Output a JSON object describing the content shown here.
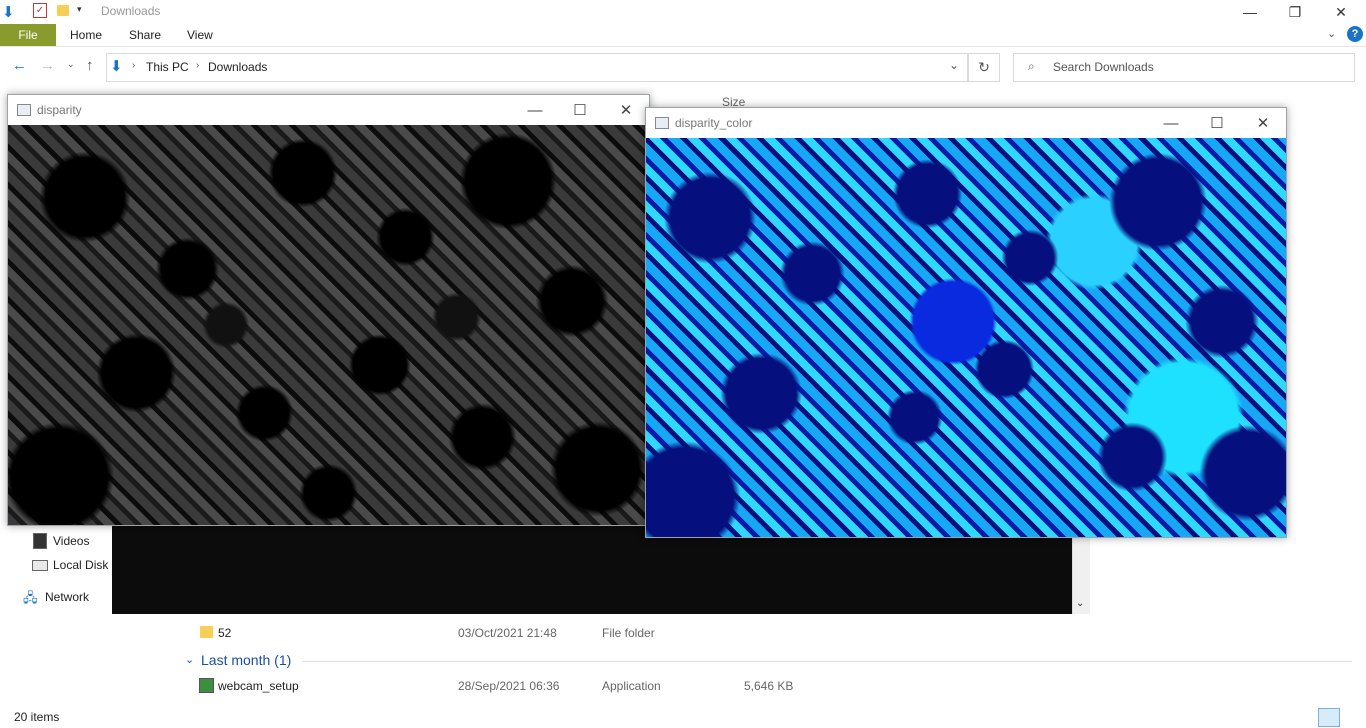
{
  "explorer": {
    "title": "Downloads",
    "ribbon": {
      "file": "File",
      "home": "Home",
      "share": "Share",
      "view": "View"
    },
    "breadcrumb": {
      "this_pc": "This PC",
      "downloads": "Downloads"
    },
    "search_placeholder": "Search Downloads",
    "columns": {
      "size": "Size"
    },
    "sidebar": {
      "videos": "Videos",
      "local_disk": "Local Disk (",
      "network": "Network"
    },
    "files": [
      {
        "name": "52",
        "date": "03/Oct/2021 21:48",
        "type": "File folder",
        "size": ""
      }
    ],
    "group_last_month": "Last month (1)",
    "files_last_month": [
      {
        "name": "webcam_setup",
        "date": "28/Sep/2021 06:36",
        "type": "Application",
        "size": "5,646 KB"
      }
    ],
    "status": "20 items"
  },
  "windows": {
    "disparity": {
      "title": "disparity"
    },
    "disparity_color": {
      "title": "disparity_color"
    }
  },
  "colors": {
    "file_tab": "#8a9b2d",
    "accent_blue": "#1a73c9"
  },
  "icons": [
    "download-arrow-icon",
    "checkmark-icon",
    "folder-icon",
    "search-icon",
    "refresh-icon",
    "help-icon"
  ]
}
